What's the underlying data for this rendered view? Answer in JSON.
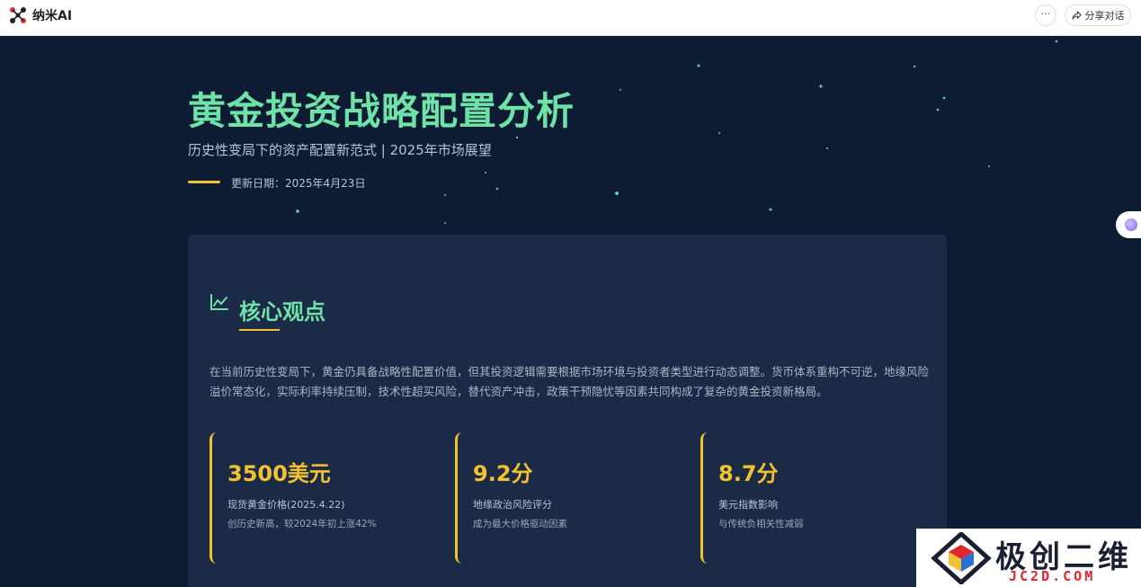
{
  "topbar": {
    "brand_name": "纳米AI",
    "more_label": "···",
    "share_label": "分享对话"
  },
  "hero": {
    "title": "黄金投资战略配置分析",
    "subtitle": "历史性变局下的资产配置新范式 | 2025年市场展望",
    "date": "更新日期：2025年4月23日"
  },
  "card": {
    "title": "核心观点",
    "body": "在当前历史性变局下，黄金仍具备战略性配置价值，但其投资逻辑需要根据市场环境与投资者类型进行动态调整。货币体系重构不可逆，地缘风险溢价常态化，实际利率持续压制，技术性超买风险，替代资产冲击，政策干预隐忧等因素共同构成了复杂的黄金投资新格局。",
    "stats": [
      {
        "value": "3500美元",
        "label": "现货黄金价格(2025.4.22)",
        "note": "创历史新高，较2024年初上涨42%"
      },
      {
        "value": "9.2分",
        "label": "地缘政治风险评分",
        "note": "成为最大价格驱动因素"
      },
      {
        "value": "8.7分",
        "label": "美元指数影响",
        "note": "与传统负相关性减弱"
      }
    ]
  },
  "watermark": {
    "title": "极创二维",
    "sub": "JC2D.COM"
  },
  "colors": {
    "background": "#0d1b33",
    "card": "#1b2a46",
    "accent_green": "#6fe2a8",
    "accent_gold": "#f2c230",
    "watermark_red": "#e2262d"
  }
}
